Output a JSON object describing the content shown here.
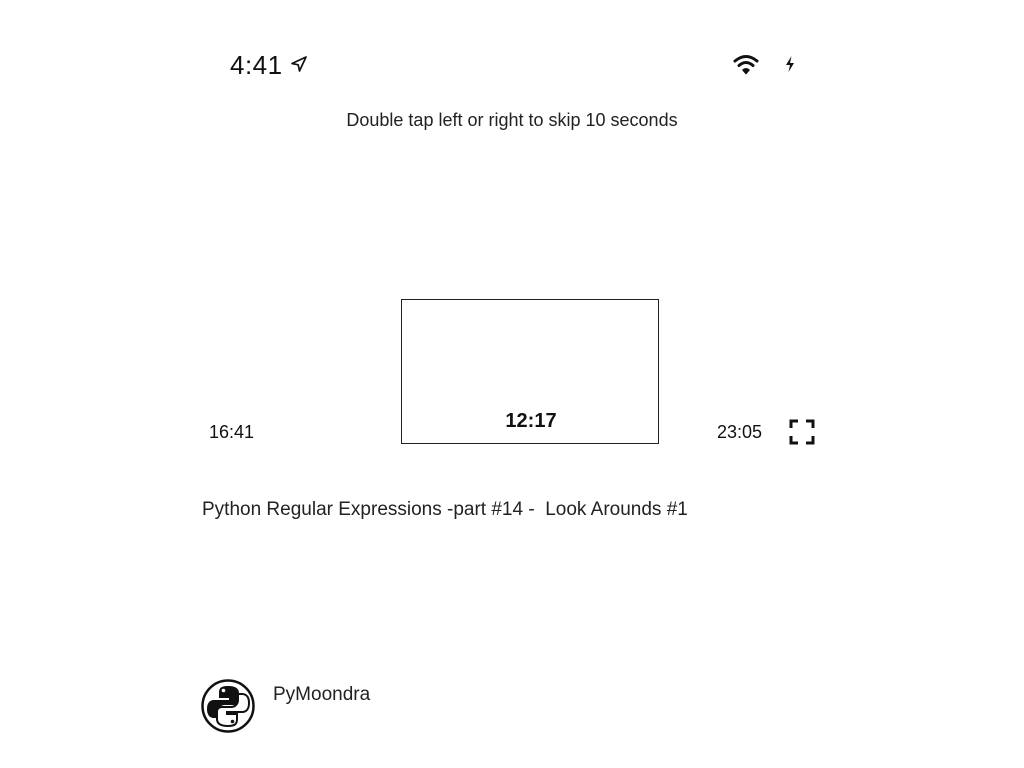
{
  "status_bar": {
    "time": "4:41",
    "icons": [
      "location-arrow-icon",
      "wifi-icon",
      "charging-bolt-icon"
    ]
  },
  "player": {
    "hint": "Double tap left or right to skip 10 seconds",
    "preview_time": "12:17",
    "current_time": "16:41",
    "total_time": "23:05",
    "fullscreen_icon": "fullscreen-icon"
  },
  "video": {
    "title": "Python Regular Expressions -part #14 -  Look Arounds #1"
  },
  "channel": {
    "name": "PyMoondra",
    "avatar_icon": "python-logo-icon"
  }
}
